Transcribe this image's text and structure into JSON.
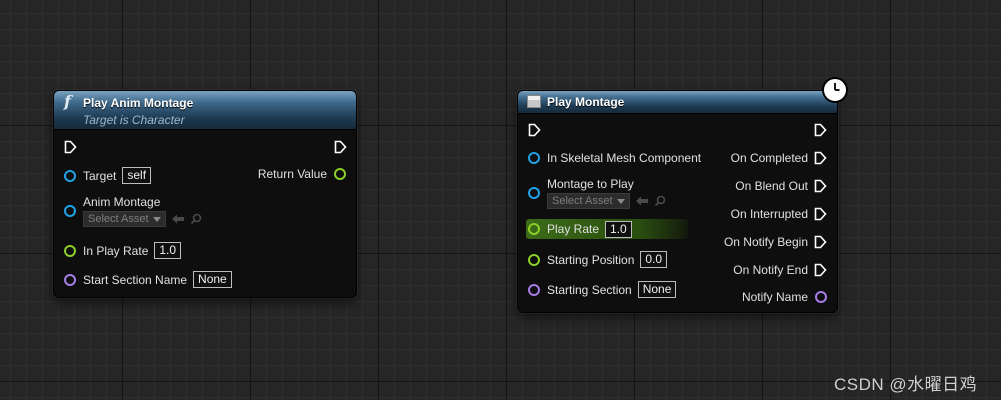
{
  "node1": {
    "title": "Play Anim Montage",
    "subtitle": "Target is Character",
    "pins": {
      "target_label": "Target",
      "target_value": "self",
      "return_value_label": "Return Value",
      "anim_montage_label": "Anim Montage",
      "anim_montage_placeholder": "Select Asset",
      "in_play_rate_label": "In Play Rate",
      "in_play_rate_value": "1.0",
      "start_section_label": "Start Section Name",
      "start_section_value": "None"
    }
  },
  "node2": {
    "title": "Play Montage",
    "inputs": {
      "skeletal_mesh_label": "In Skeletal Mesh Component",
      "montage_label": "Montage to Play",
      "montage_placeholder": "Select Asset",
      "play_rate_label": "Play Rate",
      "play_rate_value": "1.0",
      "starting_position_label": "Starting Position",
      "starting_position_value": "0.0",
      "starting_section_label": "Starting Section",
      "starting_section_value": "None"
    },
    "outputs": {
      "on_completed": "On Completed",
      "on_blend_out": "On Blend Out",
      "on_interrupted": "On Interrupted",
      "on_notify_begin": "On Notify Begin",
      "on_notify_end": "On Notify End",
      "notify_name": "Notify Name"
    }
  },
  "watermark": "CSDN @水曜日鸡",
  "colors": {
    "object_pin": "#1ea3e6",
    "float_pin": "#8ccf28",
    "name_pin": "#a87ce8",
    "header": "#3f6a8c"
  },
  "icons": {
    "function": "function-icon",
    "macro": "macro-icon",
    "latent": "clock-icon"
  }
}
